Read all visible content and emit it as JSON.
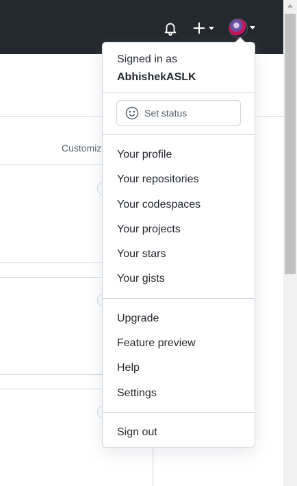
{
  "header": {
    "icons": [
      "bell-icon",
      "plus-icon",
      "avatar"
    ],
    "colors": {
      "background": "#24292f",
      "icon": "#ffffff"
    }
  },
  "background": {
    "customize_label": "Customiz"
  },
  "menu": {
    "signed_in_label": "Signed in as",
    "username": "AbhishekASLK",
    "set_status_label": "Set status",
    "group1": [
      "Your profile",
      "Your repositories",
      "Your codespaces",
      "Your projects",
      "Your stars",
      "Your gists"
    ],
    "group2": [
      "Upgrade",
      "Feature preview",
      "Help",
      "Settings"
    ],
    "sign_out_label": "Sign out"
  }
}
